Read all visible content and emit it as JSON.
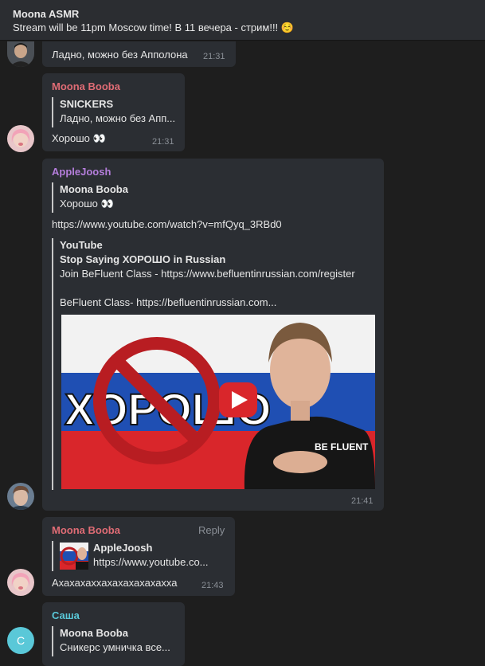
{
  "pinned": {
    "title": "Moona ASMR",
    "text": "Stream will be 11pm Moscow time! В 11 вечера - стрим!!! ☺️"
  },
  "msg1": {
    "text": "Ладно, можно без Апполона",
    "time": "21:31"
  },
  "msg2": {
    "author": "Moona Booba",
    "quote_author": "SNICKERS",
    "quote_text": "Ладно, можно без Апп...",
    "text": "Хорошо 👀",
    "time": "21:31"
  },
  "msg3": {
    "author": "AppleJoosh",
    "quote_author": "Moona Booba",
    "quote_text": "Хорошо 👀",
    "link": "https://www.youtube.com/watch?v=mfQyq_3RBd0",
    "preview_site": "YouTube",
    "preview_title": "Stop Saying ХОРОШО in Russian",
    "preview_line1": "Join BeFluent Class - https://www.befluentinrussian.com/register",
    "preview_line2": "BeFluent Class- https://befluentinrussian.com...",
    "thumb_word": "ХОРОШО",
    "shirt_text": "BE FLUENT",
    "time": "21:41"
  },
  "msg4": {
    "author": "Moona Booba",
    "reply_label": "Reply",
    "quote_author": "AppleJoosh",
    "quote_text": "https://www.youtube.co...",
    "text": "Ахахахаххахахахахахахха",
    "time": "21:43"
  },
  "msg5": {
    "author": "Саша",
    "avatar_letter": "С",
    "quote_author": "Moona Booba",
    "quote_text": "Сникерс умничка все..."
  },
  "colors": {
    "moona": "#e06c75",
    "apple": "#b57edc",
    "sasha": "#5ac8d8"
  }
}
